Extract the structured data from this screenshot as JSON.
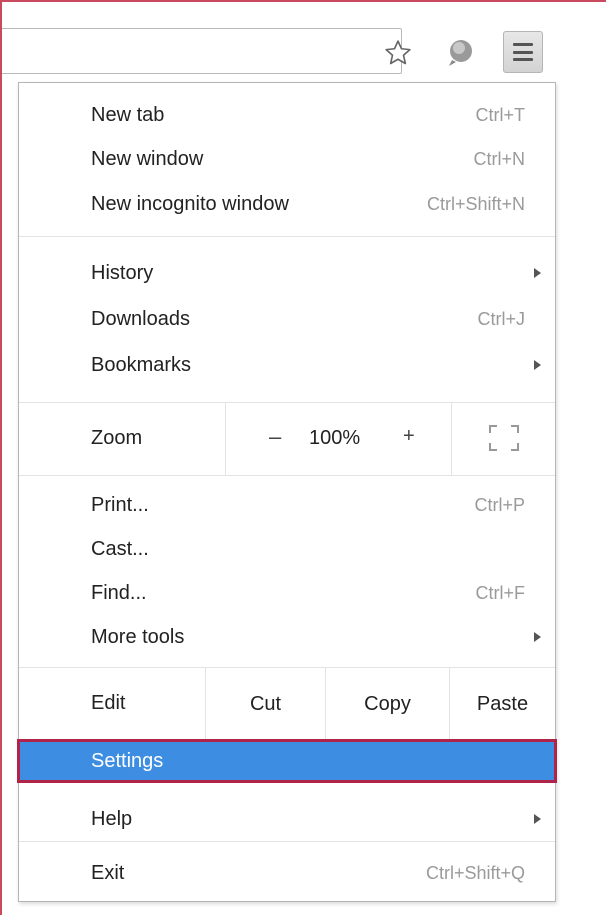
{
  "menu": {
    "group1": [
      {
        "label": "New tab",
        "shortcut": "Ctrl+T"
      },
      {
        "label": "New window",
        "shortcut": "Ctrl+N"
      },
      {
        "label": "New incognito window",
        "shortcut": "Ctrl+Shift+N"
      }
    ],
    "group2": [
      {
        "label": "History",
        "shortcut": ""
      },
      {
        "label": "Downloads",
        "shortcut": "Ctrl+J"
      },
      {
        "label": "Bookmarks",
        "shortcut": ""
      }
    ],
    "zoom": {
      "label": "Zoom",
      "minus": "–",
      "value": "100%",
      "plus": "+"
    },
    "group3": [
      {
        "label": "Print...",
        "shortcut": "Ctrl+P"
      },
      {
        "label": "Cast...",
        "shortcut": ""
      },
      {
        "label": "Find...",
        "shortcut": "Ctrl+F"
      },
      {
        "label": "More tools",
        "shortcut": ""
      }
    ],
    "edit": {
      "label": "Edit",
      "cut": "Cut",
      "copy": "Copy",
      "paste": "Paste"
    },
    "group4": [
      {
        "label": "Settings",
        "shortcut": "",
        "highlighted": true
      },
      {
        "label": "Help",
        "shortcut": ""
      }
    ],
    "exit": {
      "label": "Exit",
      "shortcut": "Ctrl+Shift+Q"
    }
  },
  "colors": {
    "highlight": "#3d8ee3",
    "highlight_outline": "#b0244a"
  },
  "icons": {
    "star": "star-icon",
    "extension": "extension-icon",
    "menu": "hamburger-menu-icon"
  }
}
